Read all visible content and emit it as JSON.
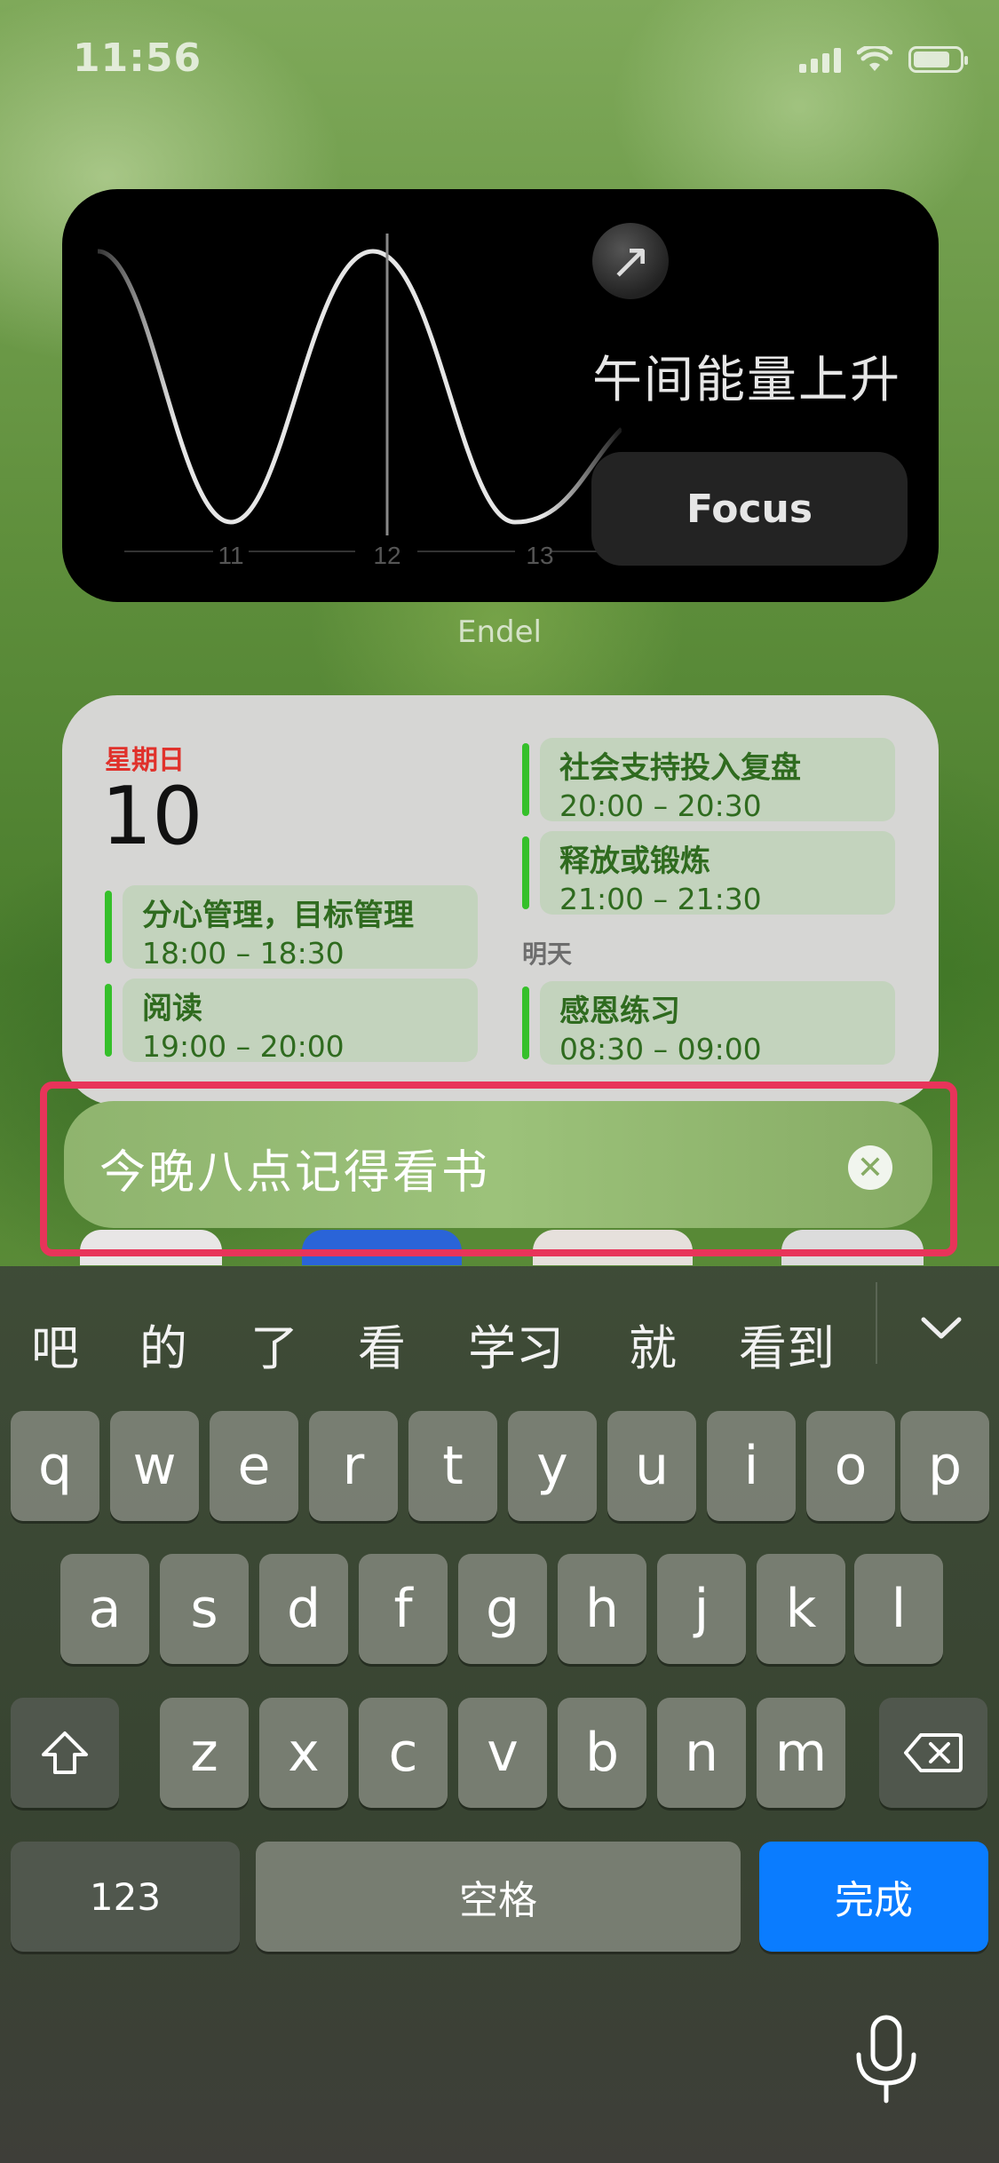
{
  "status_bar": {
    "time": "11:56"
  },
  "endel_widget": {
    "axis_labels": [
      "11",
      "12",
      "13"
    ],
    "message": "午间能量上升",
    "focus_label": "Focus",
    "app_name": "Endel"
  },
  "calendar": {
    "weekday": "星期日",
    "day": "10",
    "tomorrow_label": "明天",
    "events": [
      {
        "title": "分心管理，目标管理",
        "time": "18:00 – 18:30"
      },
      {
        "title": "阅读",
        "time": "19:00 – 20:00"
      },
      {
        "title": "社会支持投入复盘",
        "time": "20:00 – 20:30"
      },
      {
        "title": "释放或锻炼",
        "time": "21:00 – 21:30"
      },
      {
        "title": "感恩练习",
        "time": "08:30 – 09:00"
      }
    ]
  },
  "text_field": {
    "value": "今晚八点记得看书"
  },
  "keyboard": {
    "candidates": [
      "吧",
      "的",
      "了",
      "看",
      "学习",
      "就",
      "看到"
    ],
    "row1": [
      "q",
      "w",
      "e",
      "r",
      "t",
      "y",
      "u",
      "i",
      "o",
      "p"
    ],
    "row2": [
      "a",
      "s",
      "d",
      "f",
      "g",
      "h",
      "j",
      "k",
      "l"
    ],
    "row3": [
      "z",
      "x",
      "c",
      "v",
      "b",
      "n",
      "m"
    ],
    "numbers_label": "123",
    "space_label": "空格",
    "done_label": "完成"
  },
  "colors": {
    "accent_red": "#e8345a",
    "event_green": "#35c02a",
    "done_blue": "#0a7cff"
  }
}
